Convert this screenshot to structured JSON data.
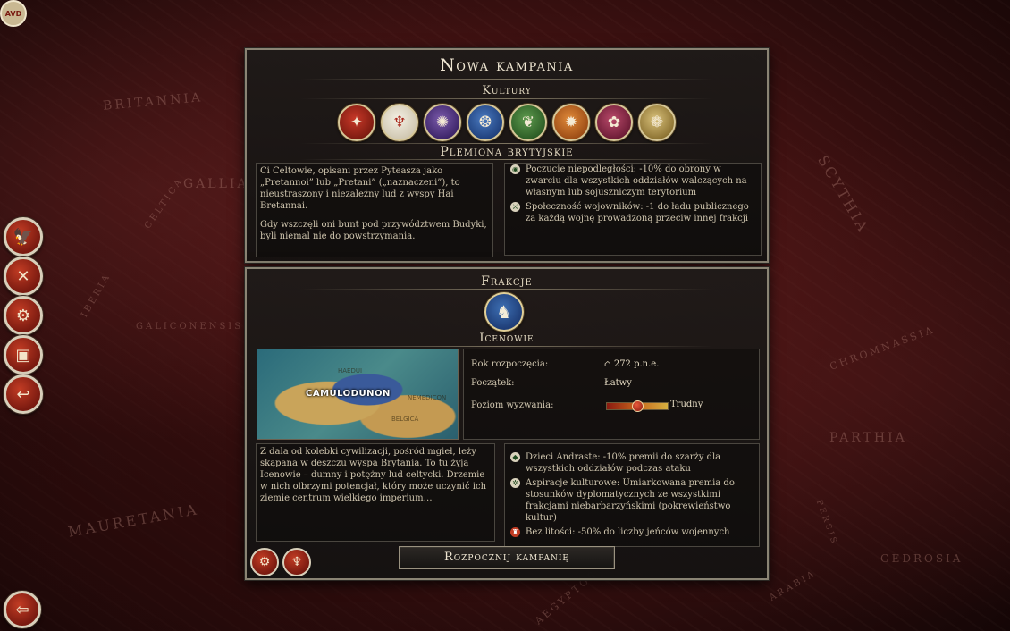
{
  "corner_badge": "AVD",
  "map_labels": [
    "BRITANNIA",
    "GALLIA",
    "CELTICA",
    "SCYTHIA",
    "MAURETANIA",
    "PARTHIA",
    "GEDROSIA",
    "AEGYPTOS",
    "CHROMNASSIA",
    "PERSIS",
    "ARABIA",
    "IBERIA",
    "GALICONENSIS",
    "ARABIA"
  ],
  "left_buttons": [
    {
      "name": "faction-eagle",
      "glyph": "🦅"
    },
    {
      "name": "battle",
      "glyph": "✕"
    },
    {
      "name": "settings",
      "glyph": "⚙"
    },
    {
      "name": "encyclopedia",
      "glyph": "▣"
    },
    {
      "name": "back",
      "glyph": "↩"
    }
  ],
  "bottom_left_button_glyph": "⇦",
  "top_panel": {
    "title": "Nowa kampania",
    "cultures_heading": "Kultury",
    "cultures": [
      {
        "icon": "roman-eagle-icon",
        "glyph": "✦",
        "color": "#a8271b"
      },
      {
        "icon": "celtic-tribe-icon",
        "glyph": "♆",
        "color": "#e8e2d2"
      },
      {
        "icon": "eastern-icon",
        "glyph": "✺",
        "color": "#5b3c8a"
      },
      {
        "icon": "hellenic-icon",
        "glyph": "❂",
        "color": "#2d5aa0"
      },
      {
        "icon": "nomad-icon",
        "glyph": "❦",
        "color": "#3f7a34"
      },
      {
        "icon": "carthage-icon",
        "glyph": "✹",
        "color": "#c2661c"
      },
      {
        "icon": "barbarian-icon",
        "glyph": "✿",
        "color": "#9a2a4a"
      },
      {
        "icon": "germanic-icon",
        "glyph": "❁",
        "color": "#b59a4a"
      }
    ],
    "selected_culture": "Plemiona brytyjskie",
    "description": [
      "Ci Celtowie, opisani przez Pyteasza jako „Pretannoi” lub „Pretani” („naznaczeni”), to nieustraszony i niezależny lud z wyspy Hai Bretannai.",
      "Gdy wszczęli oni bunt pod przywództwem Budyki, byli niemal nie do powstrzymania."
    ],
    "traits": [
      {
        "icon": "shield-icon",
        "glyph": "◉",
        "text": "Poczucie niepodległości: -10% do obrony w zwarciu dla wszystkich oddziałów walczących na własnym lub sojuszniczym terytorium"
      },
      {
        "icon": "warrior-icon",
        "glyph": "⚔",
        "text": "Społeczność wojowników: -1 do ładu publicznego za każdą wojnę prowadzoną przeciw innej frakcji"
      }
    ]
  },
  "bottom_panel": {
    "heading": "Frakcje",
    "faction_glyph": "♞",
    "faction_name": "Icenowie",
    "map_city": "CAMULODUNON",
    "map_small_labels": [
      "BELGICA",
      "NEMEDICON",
      "HAEDUI"
    ],
    "info": {
      "start_year_label": "Rok rozpoczęcia:",
      "start_year_value": "272 p.n.e.",
      "start_label": "Początek:",
      "start_value": "Łatwy",
      "challenge_label": "Poziom wyzwania:",
      "challenge_value": "Trudny",
      "challenge_level": 0.5
    },
    "description": "Z dala od kolebki cywilizacji, pośród mgieł, leży skąpana w deszczu wyspa Brytania. To tu żyją Icenowie – dumny i potężny lud celtycki. Drzemie w nich olbrzymi potencjał, który może uczynić ich ziemie centrum wielkiego imperium…",
    "traits": [
      {
        "icon": "diamond-icon",
        "glyph": "◆",
        "text": "Dzieci Andraste: -10% premii do szarży dla wszystkich oddziałów podczas ataku"
      },
      {
        "icon": "culture-icon",
        "glyph": "✲",
        "text": "Aspiracje kulturowe: Umiarkowana premia do stosunków dyplomatycznych ze wszystkimi frakcjami niebarbarzyńskimi (pokrewieństwo kultur)"
      },
      {
        "icon": "chains-icon",
        "glyph": "♜",
        "text": "Bez litości: -50% do liczby jeńców wojennych"
      }
    ],
    "start_button": "Rozpocznij kampanię",
    "settings_glyph": "⚙",
    "cup_glyph": "♆"
  }
}
